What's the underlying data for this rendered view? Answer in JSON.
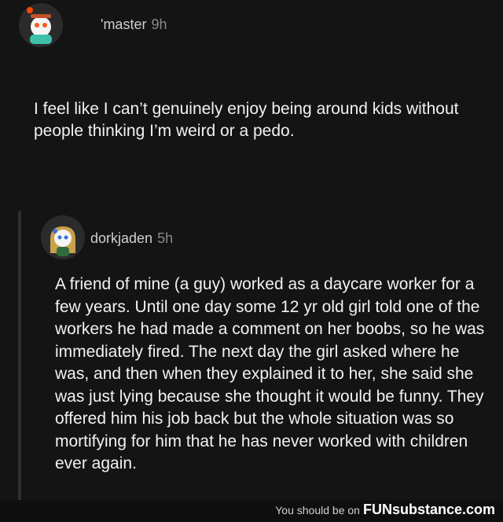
{
  "post": {
    "author": "master",
    "author_prefix": "'",
    "time": "9h",
    "text": "I feel like I can’t genuinely enjoy being around kids without people thinking I’m weird or a pedo."
  },
  "reply": {
    "author": "dorkjaden",
    "time": "5h",
    "text": "A friend of mine (a guy) worked as a daycare worker for a few years. Until one day some 12 yr old girl told one of the workers he had made a comment on her boobs, so he was immediately fired. The next day the girl asked where he was, and then when they explained it to her, she said she was just lying because she thought it would be funny. They offered him his job back but the whole situation was so mortifying for him that he has never worked with children ever again."
  },
  "footer": {
    "prefix": "You should be on",
    "brand": "FUNsubstance.com"
  },
  "colors": {
    "background": "#141414",
    "text": "#f2f2f2",
    "muted": "#8a8a8a"
  }
}
